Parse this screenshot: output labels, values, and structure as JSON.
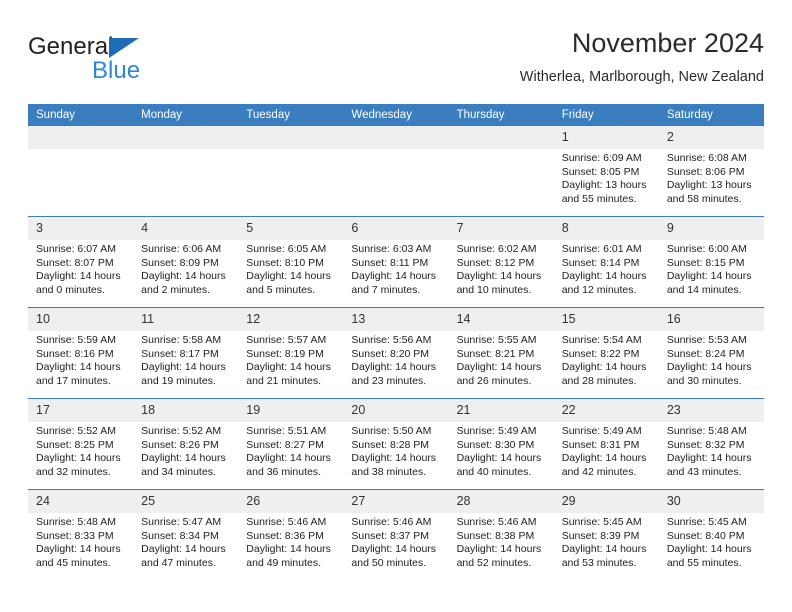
{
  "brand": {
    "name_part1": "General",
    "name_part2": "Blue",
    "triangle_color": "#1d6cb5",
    "blue_text_color": "#2e86d6"
  },
  "header": {
    "title": "November 2024",
    "subtitle": "Witherlea, Marlborough, New Zealand"
  },
  "theme": {
    "header_blue": "#3a7ec0",
    "daynum_band": "#efefef"
  },
  "weekdays": [
    "Sunday",
    "Monday",
    "Tuesday",
    "Wednesday",
    "Thursday",
    "Friday",
    "Saturday"
  ],
  "weeks": [
    [
      {
        "day": "",
        "empty": true
      },
      {
        "day": "",
        "empty": true
      },
      {
        "day": "",
        "empty": true
      },
      {
        "day": "",
        "empty": true
      },
      {
        "day": "",
        "empty": true
      },
      {
        "day": "1",
        "sunrise": "Sunrise: 6:09 AM",
        "sunset": "Sunset: 8:05 PM",
        "daylight": "Daylight: 13 hours and 55 minutes."
      },
      {
        "day": "2",
        "sunrise": "Sunrise: 6:08 AM",
        "sunset": "Sunset: 8:06 PM",
        "daylight": "Daylight: 13 hours and 58 minutes."
      }
    ],
    [
      {
        "day": "3",
        "sunrise": "Sunrise: 6:07 AM",
        "sunset": "Sunset: 8:07 PM",
        "daylight": "Daylight: 14 hours and 0 minutes."
      },
      {
        "day": "4",
        "sunrise": "Sunrise: 6:06 AM",
        "sunset": "Sunset: 8:09 PM",
        "daylight": "Daylight: 14 hours and 2 minutes."
      },
      {
        "day": "5",
        "sunrise": "Sunrise: 6:05 AM",
        "sunset": "Sunset: 8:10 PM",
        "daylight": "Daylight: 14 hours and 5 minutes."
      },
      {
        "day": "6",
        "sunrise": "Sunrise: 6:03 AM",
        "sunset": "Sunset: 8:11 PM",
        "daylight": "Daylight: 14 hours and 7 minutes."
      },
      {
        "day": "7",
        "sunrise": "Sunrise: 6:02 AM",
        "sunset": "Sunset: 8:12 PM",
        "daylight": "Daylight: 14 hours and 10 minutes."
      },
      {
        "day": "8",
        "sunrise": "Sunrise: 6:01 AM",
        "sunset": "Sunset: 8:14 PM",
        "daylight": "Daylight: 14 hours and 12 minutes."
      },
      {
        "day": "9",
        "sunrise": "Sunrise: 6:00 AM",
        "sunset": "Sunset: 8:15 PM",
        "daylight": "Daylight: 14 hours and 14 minutes."
      }
    ],
    [
      {
        "day": "10",
        "sunrise": "Sunrise: 5:59 AM",
        "sunset": "Sunset: 8:16 PM",
        "daylight": "Daylight: 14 hours and 17 minutes."
      },
      {
        "day": "11",
        "sunrise": "Sunrise: 5:58 AM",
        "sunset": "Sunset: 8:17 PM",
        "daylight": "Daylight: 14 hours and 19 minutes."
      },
      {
        "day": "12",
        "sunrise": "Sunrise: 5:57 AM",
        "sunset": "Sunset: 8:19 PM",
        "daylight": "Daylight: 14 hours and 21 minutes."
      },
      {
        "day": "13",
        "sunrise": "Sunrise: 5:56 AM",
        "sunset": "Sunset: 8:20 PM",
        "daylight": "Daylight: 14 hours and 23 minutes."
      },
      {
        "day": "14",
        "sunrise": "Sunrise: 5:55 AM",
        "sunset": "Sunset: 8:21 PM",
        "daylight": "Daylight: 14 hours and 26 minutes."
      },
      {
        "day": "15",
        "sunrise": "Sunrise: 5:54 AM",
        "sunset": "Sunset: 8:22 PM",
        "daylight": "Daylight: 14 hours and 28 minutes."
      },
      {
        "day": "16",
        "sunrise": "Sunrise: 5:53 AM",
        "sunset": "Sunset: 8:24 PM",
        "daylight": "Daylight: 14 hours and 30 minutes."
      }
    ],
    [
      {
        "day": "17",
        "sunrise": "Sunrise: 5:52 AM",
        "sunset": "Sunset: 8:25 PM",
        "daylight": "Daylight: 14 hours and 32 minutes."
      },
      {
        "day": "18",
        "sunrise": "Sunrise: 5:52 AM",
        "sunset": "Sunset: 8:26 PM",
        "daylight": "Daylight: 14 hours and 34 minutes."
      },
      {
        "day": "19",
        "sunrise": "Sunrise: 5:51 AM",
        "sunset": "Sunset: 8:27 PM",
        "daylight": "Daylight: 14 hours and 36 minutes."
      },
      {
        "day": "20",
        "sunrise": "Sunrise: 5:50 AM",
        "sunset": "Sunset: 8:28 PM",
        "daylight": "Daylight: 14 hours and 38 minutes."
      },
      {
        "day": "21",
        "sunrise": "Sunrise: 5:49 AM",
        "sunset": "Sunset: 8:30 PM",
        "daylight": "Daylight: 14 hours and 40 minutes."
      },
      {
        "day": "22",
        "sunrise": "Sunrise: 5:49 AM",
        "sunset": "Sunset: 8:31 PM",
        "daylight": "Daylight: 14 hours and 42 minutes."
      },
      {
        "day": "23",
        "sunrise": "Sunrise: 5:48 AM",
        "sunset": "Sunset: 8:32 PM",
        "daylight": "Daylight: 14 hours and 43 minutes."
      }
    ],
    [
      {
        "day": "24",
        "sunrise": "Sunrise: 5:48 AM",
        "sunset": "Sunset: 8:33 PM",
        "daylight": "Daylight: 14 hours and 45 minutes."
      },
      {
        "day": "25",
        "sunrise": "Sunrise: 5:47 AM",
        "sunset": "Sunset: 8:34 PM",
        "daylight": "Daylight: 14 hours and 47 minutes."
      },
      {
        "day": "26",
        "sunrise": "Sunrise: 5:46 AM",
        "sunset": "Sunset: 8:36 PM",
        "daylight": "Daylight: 14 hours and 49 minutes."
      },
      {
        "day": "27",
        "sunrise": "Sunrise: 5:46 AM",
        "sunset": "Sunset: 8:37 PM",
        "daylight": "Daylight: 14 hours and 50 minutes."
      },
      {
        "day": "28",
        "sunrise": "Sunrise: 5:46 AM",
        "sunset": "Sunset: 8:38 PM",
        "daylight": "Daylight: 14 hours and 52 minutes."
      },
      {
        "day": "29",
        "sunrise": "Sunrise: 5:45 AM",
        "sunset": "Sunset: 8:39 PM",
        "daylight": "Daylight: 14 hours and 53 minutes."
      },
      {
        "day": "30",
        "sunrise": "Sunrise: 5:45 AM",
        "sunset": "Sunset: 8:40 PM",
        "daylight": "Daylight: 14 hours and 55 minutes."
      }
    ]
  ]
}
